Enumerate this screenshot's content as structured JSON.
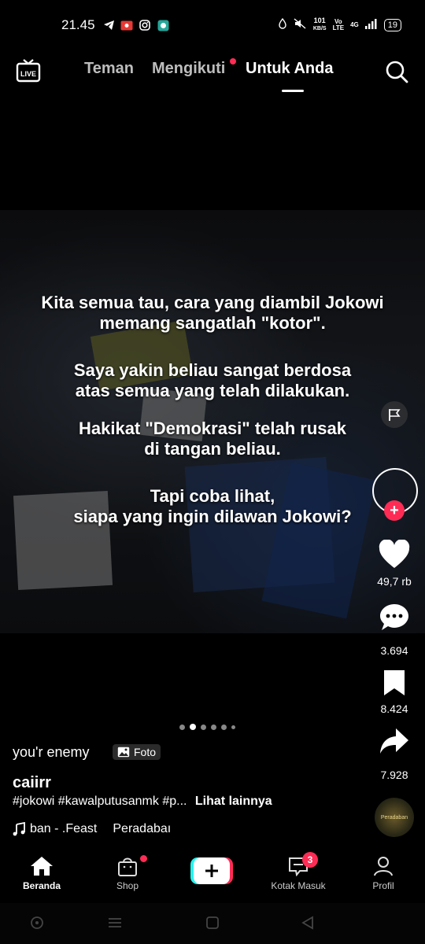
{
  "status_bar": {
    "time": "21.45",
    "speed_top": "101",
    "speed_unit": "KB/S",
    "network": "4G",
    "battery": "19"
  },
  "top_nav": {
    "tabs": [
      {
        "label": "Teman"
      },
      {
        "label": "Mengikuti"
      },
      {
        "label": "Untuk Anda"
      }
    ],
    "active_tab": "Untuk Anda",
    "live_label": "LIVE"
  },
  "post": {
    "caption_lines": [
      "Kita semua tau, cara yang diambil Jokowi",
      "memang sangatlah \"kotor\".",
      "Saya yakin beliau sangat berdosa",
      "atas semua yang telah dilakukan.",
      "Hakikat \"Demokrasi\" telah rusak",
      "di tangan beliau.",
      "Tapi coba lihat,",
      "siapa yang ingin dilawan Jokowi?"
    ],
    "photo_title": "you'r enemy",
    "photo_badge": "Foto",
    "username": "caiirr",
    "description": "#jokowi #kawalputusanmk #p...",
    "see_more": "Lihat lainnya",
    "music": "ban - .Feast",
    "music_extra": "Peradabaı",
    "disc_label": "Peradaban",
    "carousel_count": 6,
    "carousel_active": 1
  },
  "actions": {
    "likes": "49,7 rb",
    "comments": "3.694",
    "saves": "8.424",
    "shares": "7.928"
  },
  "bottom_nav": {
    "home": "Beranda",
    "shop": "Shop",
    "inbox": "Kotak Masuk",
    "inbox_badge": "3",
    "profile": "Profil"
  },
  "colors": {
    "accent": "#fe2c55",
    "cyan": "#25f4ee"
  }
}
